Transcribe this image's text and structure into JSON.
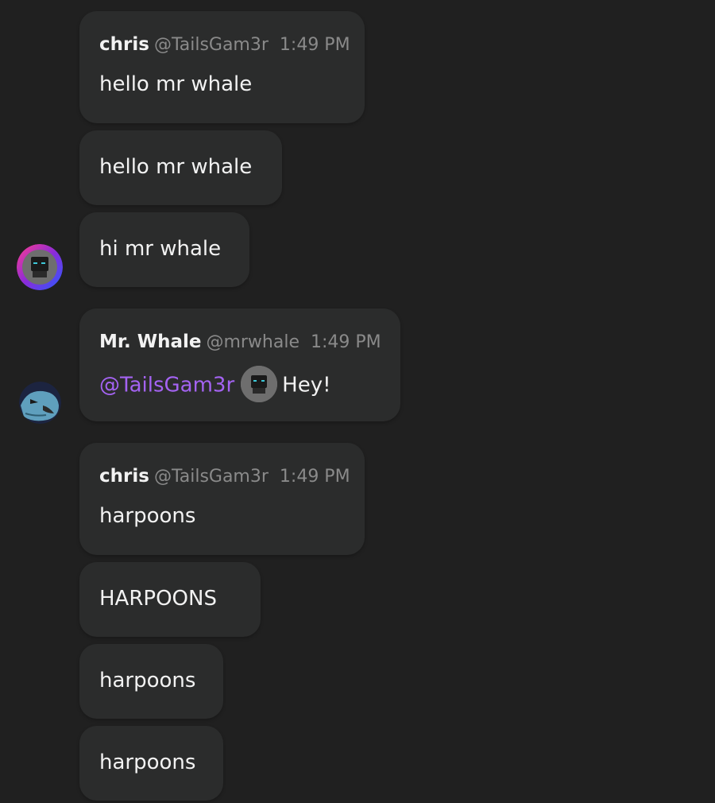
{
  "messages": [
    {
      "author": "chris",
      "handle": "@TailsGam3r",
      "time": "1:49 PM",
      "text": "hello mr whale"
    },
    {
      "text": "hello mr whale"
    },
    {
      "text": "hi mr whale"
    },
    {
      "author": "Mr. Whale",
      "handle": "@mrwhale",
      "time": "1:49 PM",
      "mention": "@TailsGam3r",
      "text": "Hey!"
    },
    {
      "author": "chris",
      "handle": "@TailsGam3r",
      "time": "1:49 PM",
      "text": "harpoons"
    },
    {
      "text": "HARPOONS"
    },
    {
      "text": "harpoons"
    },
    {
      "text": "harpoons"
    }
  ],
  "colors": {
    "background": "#202020",
    "bubble": "#2b2c2c",
    "mention": "#a463f2",
    "meta_text": "#8a8a8a",
    "message_text": "#f2f2f2"
  },
  "icons": {
    "chris_avatar": "chris-avatar-icon",
    "mrwhale_avatar": "mrwhale-avatar-icon"
  }
}
